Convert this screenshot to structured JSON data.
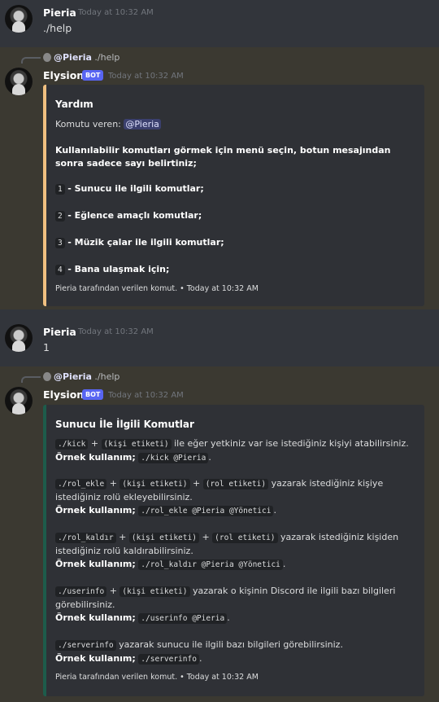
{
  "messages": {
    "m1": {
      "author": "Pieria",
      "timestamp": "Today at 10:32 AM",
      "content": "./help"
    },
    "m2": {
      "reply_mention": "@Pieria",
      "reply_text": "./help",
      "author": "Elysion",
      "badge": "BOT",
      "timestamp": "Today at 10:32 AM",
      "embed_color": "#f0c080",
      "embed": {
        "title": "Yardım",
        "requested_by_label": "Komutu veren:",
        "requested_by_mention": "@Pieria",
        "instructions": "Kullanılabilir komutları görmek için menü seçin, botun mesajından sonra sadece sayı belirtiniz;",
        "items": [
          {
            "num": "1",
            "text": "- Sunucu ile ilgili komutlar;"
          },
          {
            "num": "2",
            "text": "- Eğlence amaçlı komutlar;"
          },
          {
            "num": "3",
            "text": "- Müzik çalar ile ilgili komutlar;"
          },
          {
            "num": "4",
            "text": "- Bana ulaşmak için;"
          }
        ],
        "footer": "Pieria tarafından verilen komut. • Today at 10:32 AM"
      }
    },
    "m3": {
      "author": "Pieria",
      "timestamp": "Today at 10:32 AM",
      "content": "1"
    },
    "m4": {
      "reply_mention": "@Pieria",
      "reply_text": "./help",
      "author": "Elysion",
      "badge": "BOT",
      "timestamp": "Today at 10:32 AM",
      "embed_color": "#1d5c4b",
      "embed": {
        "title": "Sunucu İle İlgili Komutlar",
        "plus": "+",
        "example_label": "Örnek kullanım;",
        "cmd1": {
          "code": "./kick",
          "arg1": "(kişi etiketi)",
          "desc": "ile eğer yetkiniz var ise istediğiniz kişiyi atabilirsiniz.",
          "example": "./kick @Pieria"
        },
        "cmd2": {
          "code": "./rol_ekle",
          "arg1": "(kişi etiketi)",
          "arg2": "(rol etiketi)",
          "desc_a": "yazarak istediğiniz kişiye",
          "desc_b": "istediğiniz rolü ekleyebilirsiniz.",
          "example": "./rol_ekle @Pieria @Yönetici"
        },
        "cmd3": {
          "code": "./rol_kaldır",
          "arg1": "(kişi etiketi)",
          "arg2": "(rol etiketi)",
          "desc_a": "yazarak istediğiniz kişiden",
          "desc_b": "istediğiniz rolü kaldırabilirsiniz.",
          "example": "./rol_kaldır @Pieria @Yönetici"
        },
        "cmd4": {
          "code": "./userinfo",
          "arg1": "(kişi etiketi)",
          "desc_a": "yazarak o kişinin Discord ile ilgili bazı bilgileri",
          "desc_b": "görebilirsiniz.",
          "example": "./userinfo @Pieria"
        },
        "cmd5": {
          "code": "./serverinfo",
          "desc": "yazarak sunucu ile ilgili bazı bilgileri görebilirsiniz.",
          "example": "./serverinfo"
        },
        "footer": "Pieria tarafından verilen komut. • Today at 10:32 AM"
      }
    }
  }
}
